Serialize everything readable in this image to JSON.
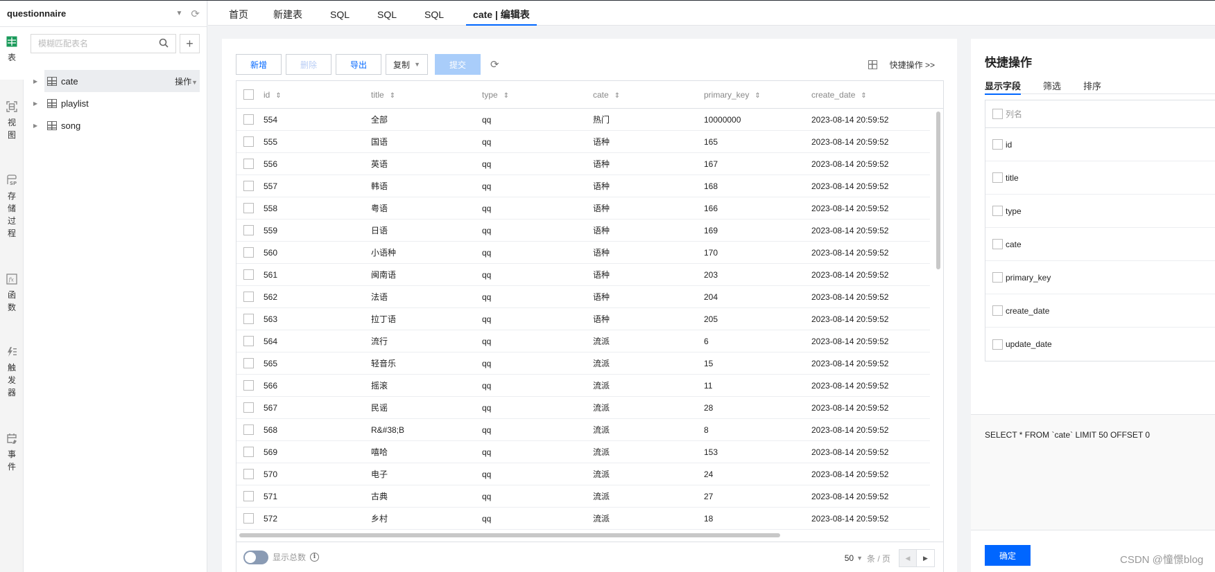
{
  "database": {
    "name": "questionnaire"
  },
  "rail": [
    {
      "label": "表",
      "icon": "table-icon",
      "active": true
    },
    {
      "label": "视图",
      "icon": "view-icon"
    },
    {
      "label": "存储过程",
      "icon": "stored-procedure-icon"
    },
    {
      "label": "函数",
      "icon": "function-icon"
    },
    {
      "label": "触发器",
      "icon": "trigger-icon"
    },
    {
      "label": "事件",
      "icon": "event-icon"
    }
  ],
  "search": {
    "placeholder": "模糊匹配表名",
    "value": ""
  },
  "tree": [
    {
      "name": "cate",
      "selected": true,
      "ops_label": "操作"
    },
    {
      "name": "playlist"
    },
    {
      "name": "song"
    }
  ],
  "tabs": [
    {
      "label": "首页"
    },
    {
      "label": "新建表"
    },
    {
      "label": "SQL"
    },
    {
      "label": "SQL"
    },
    {
      "label": "SQL"
    },
    {
      "label": "cate | 编辑表",
      "active": true
    }
  ],
  "toolbar": {
    "add_label": "新增",
    "delete_label": "删除",
    "export_label": "导出",
    "copy_label": "复制",
    "submit_label": "提交",
    "quick_ops_label": "快捷操作 >>"
  },
  "table": {
    "columns": [
      "id",
      "title",
      "type",
      "cate",
      "primary_key",
      "create_date"
    ],
    "rows": [
      [
        "554",
        "全部",
        "qq",
        "热门",
        "10000000",
        "2023-08-14 20:59:52"
      ],
      [
        "555",
        "国语",
        "qq",
        "语种",
        "165",
        "2023-08-14 20:59:52"
      ],
      [
        "556",
        "英语",
        "qq",
        "语种",
        "167",
        "2023-08-14 20:59:52"
      ],
      [
        "557",
        "韩语",
        "qq",
        "语种",
        "168",
        "2023-08-14 20:59:52"
      ],
      [
        "558",
        "粤语",
        "qq",
        "语种",
        "166",
        "2023-08-14 20:59:52"
      ],
      [
        "559",
        "日语",
        "qq",
        "语种",
        "169",
        "2023-08-14 20:59:52"
      ],
      [
        "560",
        "小语种",
        "qq",
        "语种",
        "170",
        "2023-08-14 20:59:52"
      ],
      [
        "561",
        "闽南语",
        "qq",
        "语种",
        "203",
        "2023-08-14 20:59:52"
      ],
      [
        "562",
        "法语",
        "qq",
        "语种",
        "204",
        "2023-08-14 20:59:52"
      ],
      [
        "563",
        "拉丁语",
        "qq",
        "语种",
        "205",
        "2023-08-14 20:59:52"
      ],
      [
        "564",
        "流行",
        "qq",
        "流派",
        "6",
        "2023-08-14 20:59:52"
      ],
      [
        "565",
        "轻音乐",
        "qq",
        "流派",
        "15",
        "2023-08-14 20:59:52"
      ],
      [
        "566",
        "摇滚",
        "qq",
        "流派",
        "11",
        "2023-08-14 20:59:52"
      ],
      [
        "567",
        "民谣",
        "qq",
        "流派",
        "28",
        "2023-08-14 20:59:52"
      ],
      [
        "568",
        "R&#38;B",
        "qq",
        "流派",
        "8",
        "2023-08-14 20:59:52"
      ],
      [
        "569",
        "嘻哈",
        "qq",
        "流派",
        "153",
        "2023-08-14 20:59:52"
      ],
      [
        "570",
        "电子",
        "qq",
        "流派",
        "24",
        "2023-08-14 20:59:52"
      ],
      [
        "571",
        "古典",
        "qq",
        "流派",
        "27",
        "2023-08-14 20:59:52"
      ],
      [
        "572",
        "乡村",
        "qq",
        "流派",
        "18",
        "2023-08-14 20:59:52"
      ]
    ]
  },
  "footer": {
    "show_total_label": "显示总数",
    "show_total_on": false,
    "page_size": "50",
    "page_size_unit": "条 / 页"
  },
  "quick_panel": {
    "title": "快捷操作",
    "tabs": [
      {
        "label": "显示字段",
        "active": true
      },
      {
        "label": "筛选"
      },
      {
        "label": "排序"
      }
    ],
    "field_header": "列名",
    "fields": [
      "id",
      "title",
      "type",
      "cate",
      "primary_key",
      "create_date",
      "update_date"
    ],
    "sql": "SELECT * FROM `cate` LIMIT 50 OFFSET 0",
    "confirm_label": "确定"
  },
  "watermark": "CSDN @憧憬blog"
}
